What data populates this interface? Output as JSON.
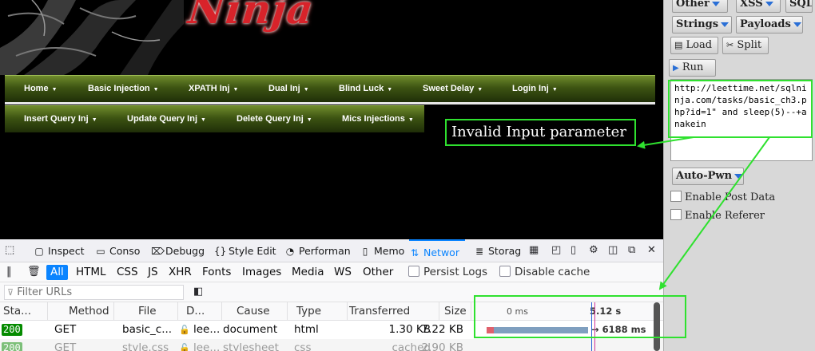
{
  "site": {
    "logo_text": "Ninja",
    "menu_row1": [
      {
        "label": "Home"
      },
      {
        "label": "Basic Injection"
      },
      {
        "label": "XPATH Inj"
      },
      {
        "label": "Dual Inj"
      },
      {
        "label": "Blind Luck"
      },
      {
        "label": "Sweet Delay"
      },
      {
        "label": "Login Inj"
      }
    ],
    "menu_row2": [
      {
        "label": "Insert Query Inj"
      },
      {
        "label": "Update Query Inj"
      },
      {
        "label": "Delete Query Inj"
      },
      {
        "label": "Mics Injections"
      }
    ],
    "annotation": "Invalid Input parameter"
  },
  "side_panel": {
    "other_label": "Other",
    "xss_label": "XSS",
    "sql_label": "SQL",
    "strings_label": "Strings",
    "payloads_label": "Payloads",
    "load_label": "Load",
    "split_label": "Split",
    "run_label": "Run",
    "url_value": "http://leettime.net/sqlninja.com/tasks/basic_ch3.php?id=1\" and sleep(5)--+anakein",
    "autopwn_label": "Auto-Pwn",
    "enable_post_label": "Enable Post Data",
    "enable_referer_label": "Enable Referer"
  },
  "devtools": {
    "tabs": {
      "inspector": "Inspect",
      "console": "Conso",
      "debugger": "Debugg",
      "style_editor": "Style Edit",
      "performance": "Performan",
      "memory": "Memo",
      "network": "Networ",
      "storage": "Storag"
    },
    "filters": [
      "All",
      "HTML",
      "CSS",
      "JS",
      "XHR",
      "Fonts",
      "Images",
      "Media",
      "WS",
      "Other"
    ],
    "persist_logs": "Persist Logs",
    "disable_cache": "Disable cache",
    "filter_placeholder": "Filter URLs",
    "columns": {
      "status": "Sta...",
      "method": "Method",
      "file": "File",
      "domain": "D...",
      "cause": "Cause",
      "type": "Type",
      "transferred": "Transferred",
      "size": "Size"
    },
    "waterfall": {
      "start": "0 ms",
      "mark": "5.12 s",
      "duration": "→ 6188 ms"
    },
    "requests": [
      {
        "status": "200",
        "method": "GET",
        "file": "basic_c...",
        "domain": "lee...",
        "cause": "document",
        "type": "html",
        "transferred": "1.30 KB",
        "size": "7.22 KB"
      },
      {
        "status": "200",
        "method": "GET",
        "file": "style.css",
        "domain": "lee...",
        "cause": "stylesheet",
        "type": "css",
        "transferred": "cached",
        "size": "2.90 KB"
      }
    ]
  },
  "colors": {
    "accent": "#0a84ff",
    "highlight_green": "#2fe12f",
    "menu_green": "#3d5412",
    "logo_red": "#d8232a",
    "status_ok": "#058b00"
  }
}
